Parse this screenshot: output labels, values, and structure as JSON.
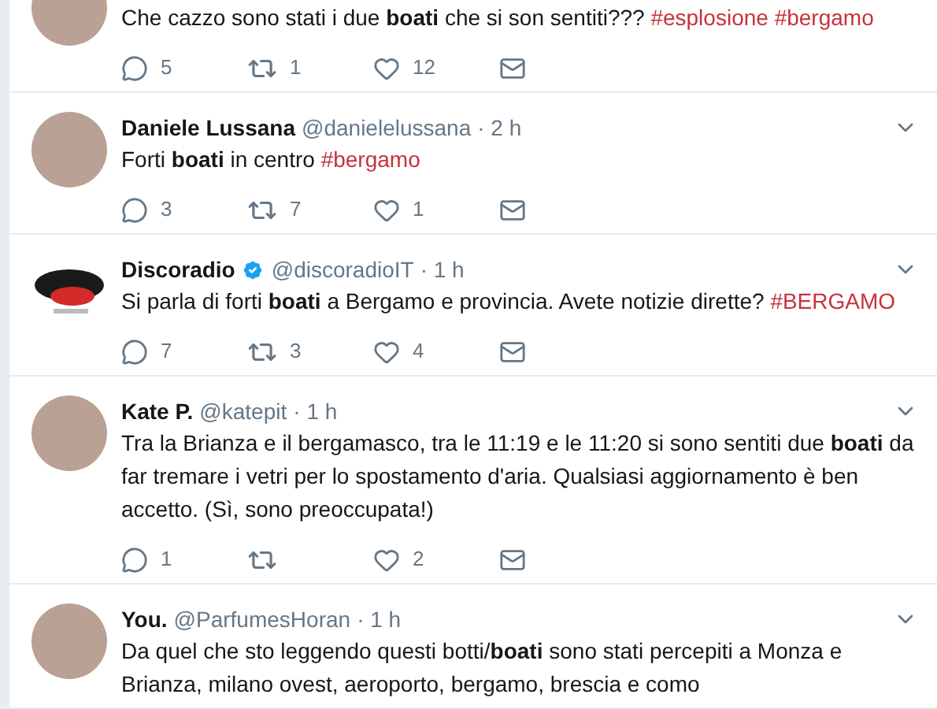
{
  "tweets": [
    {
      "kind": "person",
      "body": "Che cazzo sono stati i due **boati** che si son sentiti???",
      "hashtags": [
        "#esplosione",
        "#bergamo"
      ],
      "replies": "5",
      "retweets": "1",
      "likes": "12"
    },
    {
      "kind": "person",
      "name": "Daniele Lussana",
      "handle": "@danielelussana",
      "time": "· 2 h",
      "verified": false,
      "body": "Forti **boati** in centro",
      "hashtags": [
        "#bergamo"
      ],
      "replies": "3",
      "retweets": "7",
      "likes": "1"
    },
    {
      "kind": "brand",
      "name": "Discoradio",
      "handle": "@discoradioIT",
      "time": "· 1 h",
      "verified": true,
      "body": "Si parla di forti **boati** a Bergamo e provincia. Avete notizie dirette?",
      "hashtags": [
        "#BERGAMO"
      ],
      "replies": "7",
      "retweets": "3",
      "likes": "4"
    },
    {
      "kind": "person",
      "name": "Kate P.",
      "handle": "@katepit",
      "time": "· 1 h",
      "verified": false,
      "body": "Tra la Brianza e il bergamasco, tra le 11:19 e le 11:20 si sono sentiti due **boati** da far tremare i vetri per lo spostamento d'aria. Qualsiasi aggiornamento è ben accetto. (Sì, sono preoccupata!)",
      "replies": "1",
      "likes": "2"
    },
    {
      "kind": "person",
      "name": "You.",
      "handle": "@ParfumesHoran",
      "time": "· 1 h",
      "verified": false,
      "body": "Da quel che sto leggendo questi botti/**boati** sono stati percepiti a Monza e Brianza, milano ovest, aeroporto, bergamo, brescia e como"
    }
  ]
}
